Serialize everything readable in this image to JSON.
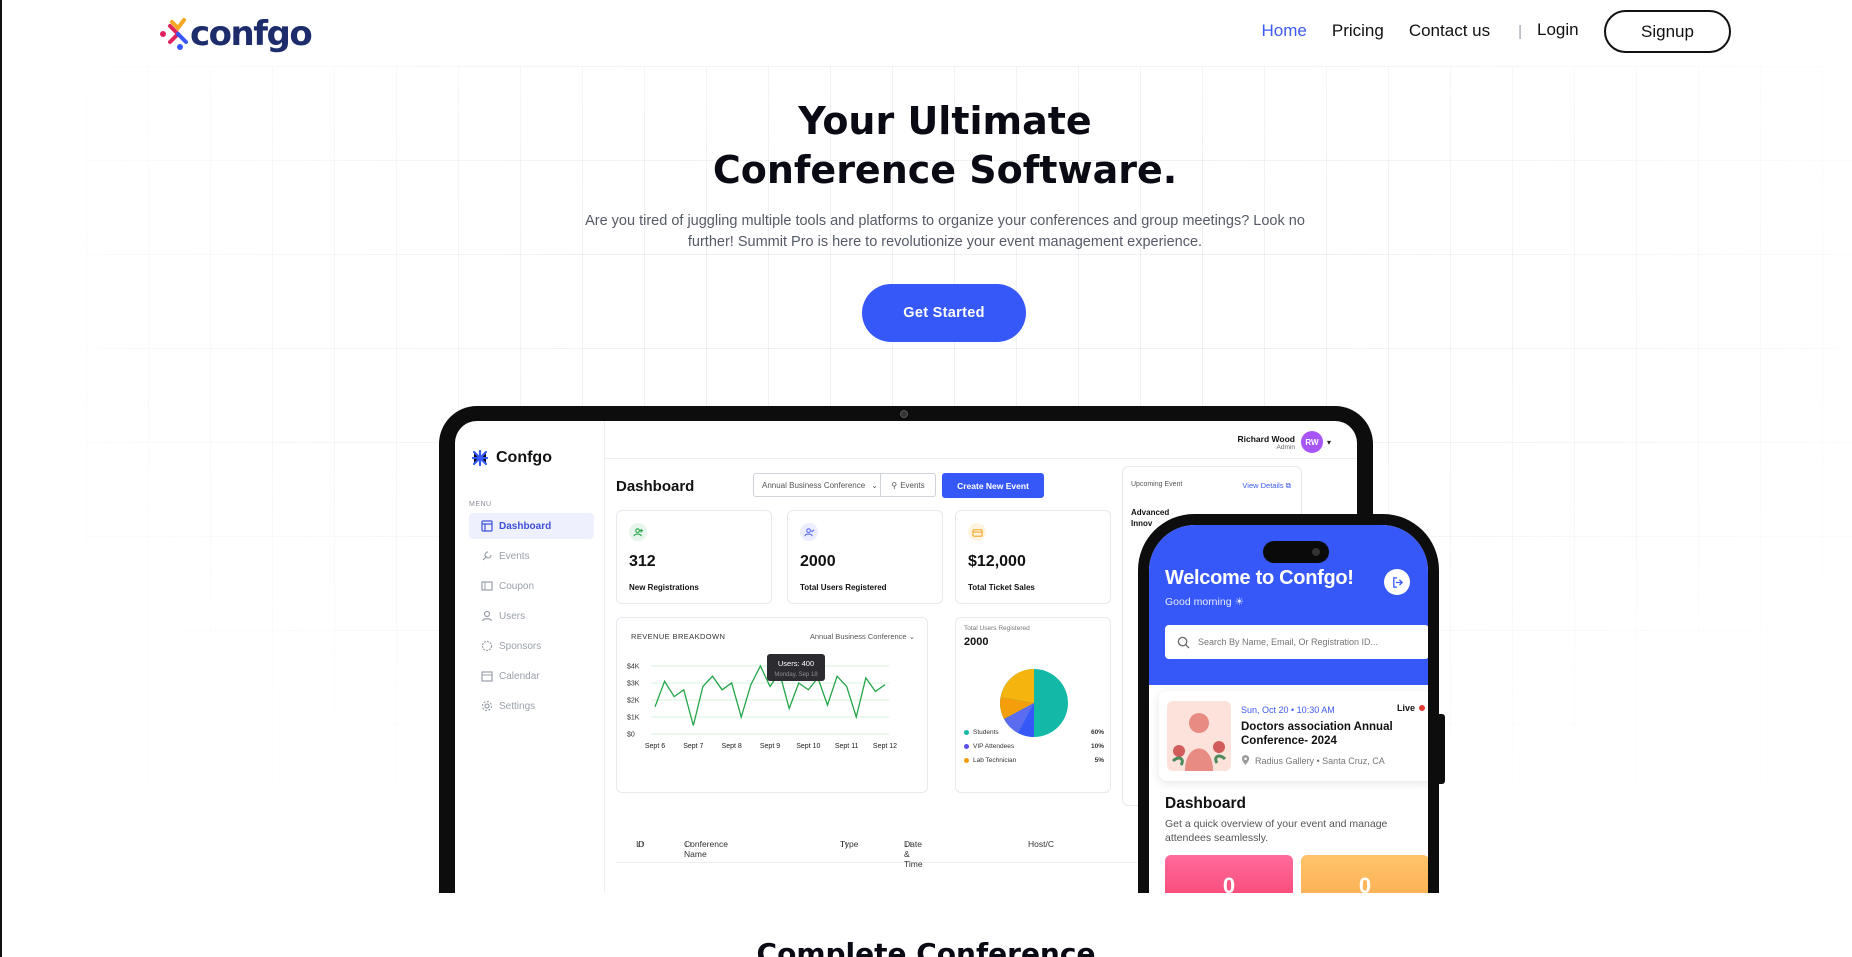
{
  "brand": {
    "name": "confgo",
    "colors": {
      "navy": "#1d2d6b",
      "pink": "#e0245e",
      "orange": "#f5a623",
      "blue": "#3758f9"
    }
  },
  "nav": {
    "links": [
      {
        "label": "Home",
        "active": true
      },
      {
        "label": "Pricing",
        "active": false
      },
      {
        "label": "Contact us",
        "active": false
      }
    ],
    "separator": "|",
    "login": "Login",
    "signup": "Signup"
  },
  "hero": {
    "title_line1": "Your Ultimate",
    "title_line2": "Conference Software.",
    "subtitle": "Are you tired of juggling multiple tools and platforms to organize your conferences and group meetings? Look no further! Summit Pro is here to revolutionize your event management experience.",
    "cta": "Get Started"
  },
  "dashboard": {
    "brand": "Confgo",
    "menu_label": "MENU",
    "menu": [
      {
        "label": "Dashboard",
        "icon": "layout-icon",
        "active": true
      },
      {
        "label": "Events",
        "icon": "wrench-icon",
        "active": false
      },
      {
        "label": "Coupon",
        "icon": "coupon-icon",
        "active": false
      },
      {
        "label": "Users",
        "icon": "user-icon",
        "active": false
      },
      {
        "label": "Sponsors",
        "icon": "badge-icon",
        "active": false
      },
      {
        "label": "Calendar",
        "icon": "calendar-icon",
        "active": false
      },
      {
        "label": "Settings",
        "icon": "gear-icon",
        "active": false
      }
    ],
    "user": {
      "name": "Richard Wood",
      "role": "Admin",
      "initials": "RW"
    },
    "title": "Dashboard",
    "conference_select": "Annual Business Conference",
    "events_button": "Events",
    "create_button": "Create New Event",
    "stats": [
      {
        "value": "312",
        "label": "New Registrations",
        "icon": "user-plus-icon",
        "color": "#22a447"
      },
      {
        "value": "2000",
        "label": "Total Users Registered",
        "icon": "user-check-icon",
        "color": "#5b6cf0"
      },
      {
        "value": "$12,000",
        "label": "Total Ticket Sales",
        "icon": "card-icon",
        "color": "#f5a623"
      }
    ],
    "revenue": {
      "title": "REVENUE BREAKDOWN",
      "select": "Annual Business Conference",
      "tooltip_value": "Users: 400",
      "tooltip_date": "Monday, Sep 18"
    },
    "pie": {
      "title": "Total Users Registered",
      "value": "2000",
      "legend": [
        {
          "label": "Students",
          "pct": "60%",
          "color": "#14b8a6"
        },
        {
          "label": "VIP Attendees",
          "pct": "10%",
          "color": "#5b4ff0"
        },
        {
          "label": "Lab Technician",
          "pct": "5%",
          "color": "#f59e0b"
        }
      ]
    },
    "upcoming": {
      "title": "Upcoming Event",
      "link": "View Details",
      "name": "Advanced Innov"
    },
    "table_headers": [
      "ID",
      "Conference Name",
      "Type",
      "Date & Time",
      "Host/C"
    ]
  },
  "chart_data": {
    "type": "line",
    "title": "REVENUE BREAKDOWN",
    "xlabel": "",
    "ylabel": "",
    "categories": [
      "Sept 6",
      "Sept 7",
      "Sept 8",
      "Sept 9",
      "Sept 10",
      "Sept 11",
      "Sept 12"
    ],
    "y_ticks": [
      "$0",
      "$1K",
      "$2K",
      "$3K",
      "$4K"
    ],
    "ylim": [
      0,
      4000
    ],
    "series": [
      {
        "name": "Users",
        "color": "#22a447",
        "x": [
          0,
          0.25,
          0.5,
          0.75,
          1,
          1.25,
          1.5,
          1.75,
          2,
          2.25,
          2.5,
          2.75,
          3,
          3.25,
          3.5,
          3.75,
          4,
          4.25,
          4.5,
          4.75,
          5,
          5.25,
          5.5,
          5.75,
          6
        ],
        "values": [
          1600,
          3100,
          2200,
          2600,
          500,
          2800,
          3400,
          2600,
          3000,
          1000,
          2900,
          4000,
          2800,
          3600,
          1500,
          3000,
          2600,
          3300,
          1700,
          3400,
          2800,
          1000,
          3300,
          2500,
          2900
        ]
      }
    ],
    "grid": true
  },
  "phone": {
    "welcome": "Welcome to Confgo!",
    "greeting": "Good morning ☀",
    "search_placeholder": "Search By Name, Email, Or Registration ID...",
    "event": {
      "date": "Sun, Oct 20 • 10:30 AM",
      "live": "Live",
      "name": "Doctors association Annual Conference- 2024",
      "location": "Radius Gallery • Santa Cruz, CA"
    },
    "dash_title": "Dashboard",
    "dash_sub": "Get a quick overview of your event and manage attendees seamlessly.",
    "tiles": [
      "0",
      "0"
    ]
  },
  "section_title": "Complete Conference"
}
